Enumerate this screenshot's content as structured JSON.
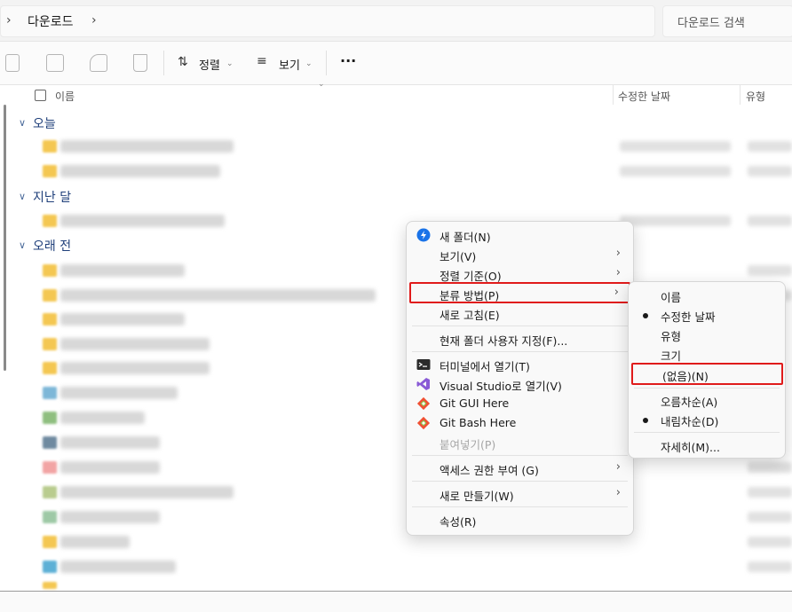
{
  "address_bar": {
    "path": "다운로드",
    "search_placeholder": "다운로드 검색"
  },
  "toolbar": {
    "sort_label": "정렬",
    "view_label": "보기",
    "more_label": "···"
  },
  "columns": {
    "name": "이름",
    "date_modified": "수정한 날짜",
    "type": "유형"
  },
  "groups": {
    "today": "오늘",
    "last_month": "지난 달",
    "long_ago": "오래 전"
  },
  "context_menu": {
    "items": [
      {
        "label": "새 폴더(N)",
        "icon": "new-folder-icon"
      },
      {
        "label": "보기(V)",
        "submenu": true
      },
      {
        "label": "정렬 기준(O)",
        "submenu": true
      },
      {
        "label": "분류 방법(P)",
        "submenu": true,
        "highlighted": true
      },
      {
        "label": "새로 고침(E)"
      },
      {
        "label": "현재 폴더 사용자 지정(F)..."
      },
      {
        "label": "터미널에서 열기(T)",
        "icon": "terminal-icon"
      },
      {
        "label": "Visual Studio로 열기(V)",
        "icon": "visual-studio-icon"
      },
      {
        "label": "Git GUI Here",
        "icon": "git-icon"
      },
      {
        "label": "Git Bash Here",
        "icon": "git-icon"
      },
      {
        "label": "붙여넣기(P)",
        "disabled": true
      },
      {
        "label": "액세스 권한 부여 (G)",
        "submenu": true
      },
      {
        "label": "새로 만들기(W)",
        "submenu": true
      },
      {
        "label": "속성(R)"
      }
    ]
  },
  "group_by_submenu": {
    "items": [
      {
        "label": "이름",
        "checked": false
      },
      {
        "label": "수정한 날짜",
        "checked": true
      },
      {
        "label": "유형",
        "checked": false
      },
      {
        "label": "크기",
        "checked": false
      },
      {
        "label": "(없음)(N)",
        "checked": false,
        "highlighted": true
      },
      {
        "label": "오름차순(A)",
        "checked": false
      },
      {
        "label": "내림차순(D)",
        "checked": true
      },
      {
        "label": "자세히(M)...",
        "checked": false
      }
    ]
  },
  "colors": {
    "highlight_box": "#e01b1b",
    "group_header": "#1f3f7a",
    "folder_yellow": "#f4c752"
  }
}
